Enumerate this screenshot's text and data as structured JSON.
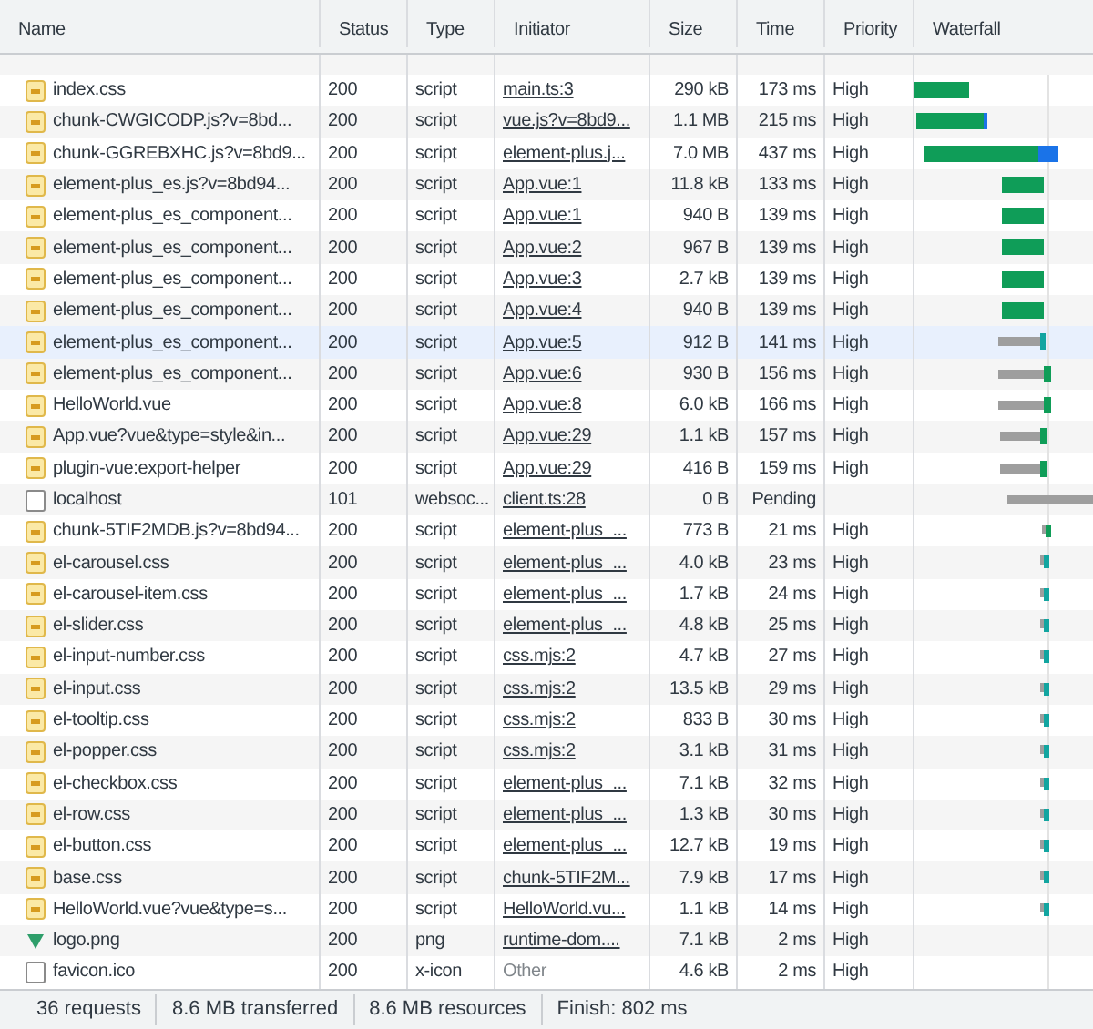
{
  "columns": [
    "Name",
    "Status",
    "Type",
    "Initiator",
    "Size",
    "Time",
    "Priority",
    "Waterfall"
  ],
  "rows": [
    {
      "name": "index.css",
      "kind": "script",
      "status": "200",
      "type": "script",
      "initiator": "main.ts:3",
      "initiator_link": true,
      "size": "290 kB",
      "time": "173 ms",
      "priority": "High",
      "selected": false
    },
    {
      "name": "chunk-CWGICODP.js?v=8bd...",
      "kind": "script",
      "status": "200",
      "type": "script",
      "initiator": "vue.js?v=8bd9...",
      "initiator_link": true,
      "size": "1.1 MB",
      "time": "215 ms",
      "priority": "High",
      "selected": false
    },
    {
      "name": "chunk-GGREBXHC.js?v=8bd9...",
      "kind": "script",
      "status": "200",
      "type": "script",
      "initiator": "element-plus.j...",
      "initiator_link": true,
      "size": "7.0 MB",
      "time": "437 ms",
      "priority": "High",
      "selected": false
    },
    {
      "name": "element-plus_es.js?v=8bd94...",
      "kind": "script",
      "status": "200",
      "type": "script",
      "initiator": "App.vue:1",
      "initiator_link": true,
      "size": "11.8 kB",
      "time": "133 ms",
      "priority": "High",
      "selected": false
    },
    {
      "name": "element-plus_es_component...",
      "kind": "script",
      "status": "200",
      "type": "script",
      "initiator": "App.vue:1",
      "initiator_link": true,
      "size": "940 B",
      "time": "139 ms",
      "priority": "High",
      "selected": false
    },
    {
      "name": "element-plus_es_component...",
      "kind": "script",
      "status": "200",
      "type": "script",
      "initiator": "App.vue:2",
      "initiator_link": true,
      "size": "967 B",
      "time": "139 ms",
      "priority": "High",
      "selected": false
    },
    {
      "name": "element-plus_es_component...",
      "kind": "script",
      "status": "200",
      "type": "script",
      "initiator": "App.vue:3",
      "initiator_link": true,
      "size": "2.7 kB",
      "time": "139 ms",
      "priority": "High",
      "selected": false
    },
    {
      "name": "element-plus_es_component...",
      "kind": "script",
      "status": "200",
      "type": "script",
      "initiator": "App.vue:4",
      "initiator_link": true,
      "size": "940 B",
      "time": "139 ms",
      "priority": "High",
      "selected": false
    },
    {
      "name": "element-plus_es_component...",
      "kind": "script",
      "status": "200",
      "type": "script",
      "initiator": "App.vue:5",
      "initiator_link": true,
      "size": "912 B",
      "time": "141 ms",
      "priority": "High",
      "selected": true
    },
    {
      "name": "element-plus_es_component...",
      "kind": "script",
      "status": "200",
      "type": "script",
      "initiator": "App.vue:6",
      "initiator_link": true,
      "size": "930 B",
      "time": "156 ms",
      "priority": "High",
      "selected": false
    },
    {
      "name": "HelloWorld.vue",
      "kind": "script",
      "status": "200",
      "type": "script",
      "initiator": "App.vue:8",
      "initiator_link": true,
      "size": "6.0 kB",
      "time": "166 ms",
      "priority": "High",
      "selected": false
    },
    {
      "name": "App.vue?vue&type=style&in...",
      "kind": "script",
      "status": "200",
      "type": "script",
      "initiator": "App.vue:29",
      "initiator_link": true,
      "size": "1.1 kB",
      "time": "157 ms",
      "priority": "High",
      "selected": false
    },
    {
      "name": "plugin-vue:export-helper",
      "kind": "script",
      "status": "200",
      "type": "script",
      "initiator": "App.vue:29",
      "initiator_link": true,
      "size": "416 B",
      "time": "159 ms",
      "priority": "High",
      "selected": false
    },
    {
      "name": "localhost",
      "kind": "document",
      "status": "101",
      "type": "websoc...",
      "initiator": "client.ts:28",
      "initiator_link": true,
      "size": "0 B",
      "time": "Pending",
      "priority": "",
      "selected": false
    },
    {
      "name": "chunk-5TIF2MDB.js?v=8bd94...",
      "kind": "script",
      "status": "200",
      "type": "script",
      "initiator": "element-plus_...",
      "initiator_link": true,
      "size": "773 B",
      "time": "21 ms",
      "priority": "High",
      "selected": false
    },
    {
      "name": "el-carousel.css",
      "kind": "script",
      "status": "200",
      "type": "script",
      "initiator": "element-plus_...",
      "initiator_link": true,
      "size": "4.0 kB",
      "time": "23 ms",
      "priority": "High",
      "selected": false
    },
    {
      "name": "el-carousel-item.css",
      "kind": "script",
      "status": "200",
      "type": "script",
      "initiator": "element-plus_...",
      "initiator_link": true,
      "size": "1.7 kB",
      "time": "24 ms",
      "priority": "High",
      "selected": false
    },
    {
      "name": "el-slider.css",
      "kind": "script",
      "status": "200",
      "type": "script",
      "initiator": "element-plus_...",
      "initiator_link": true,
      "size": "4.8 kB",
      "time": "25 ms",
      "priority": "High",
      "selected": false
    },
    {
      "name": "el-input-number.css",
      "kind": "script",
      "status": "200",
      "type": "script",
      "initiator": "css.mjs:2",
      "initiator_link": true,
      "size": "4.7 kB",
      "time": "27 ms",
      "priority": "High",
      "selected": false
    },
    {
      "name": "el-input.css",
      "kind": "script",
      "status": "200",
      "type": "script",
      "initiator": "css.mjs:2",
      "initiator_link": true,
      "size": "13.5 kB",
      "time": "29 ms",
      "priority": "High",
      "selected": false
    },
    {
      "name": "el-tooltip.css",
      "kind": "script",
      "status": "200",
      "type": "script",
      "initiator": "css.mjs:2",
      "initiator_link": true,
      "size": "833 B",
      "time": "30 ms",
      "priority": "High",
      "selected": false
    },
    {
      "name": "el-popper.css",
      "kind": "script",
      "status": "200",
      "type": "script",
      "initiator": "css.mjs:2",
      "initiator_link": true,
      "size": "3.1 kB",
      "time": "31 ms",
      "priority": "High",
      "selected": false
    },
    {
      "name": "el-checkbox.css",
      "kind": "script",
      "status": "200",
      "type": "script",
      "initiator": "element-plus_...",
      "initiator_link": true,
      "size": "7.1 kB",
      "time": "32 ms",
      "priority": "High",
      "selected": false
    },
    {
      "name": "el-row.css",
      "kind": "script",
      "status": "200",
      "type": "script",
      "initiator": "element-plus_...",
      "initiator_link": true,
      "size": "1.3 kB",
      "time": "30 ms",
      "priority": "High",
      "selected": false
    },
    {
      "name": "el-button.css",
      "kind": "script",
      "status": "200",
      "type": "script",
      "initiator": "element-plus_...",
      "initiator_link": true,
      "size": "12.7 kB",
      "time": "19 ms",
      "priority": "High",
      "selected": false
    },
    {
      "name": "base.css",
      "kind": "script",
      "status": "200",
      "type": "script",
      "initiator": "chunk-5TIF2M...",
      "initiator_link": true,
      "size": "7.9 kB",
      "time": "17 ms",
      "priority": "High",
      "selected": false
    },
    {
      "name": "HelloWorld.vue?vue&type=s...",
      "kind": "script",
      "status": "200",
      "type": "script",
      "initiator": "HelloWorld.vu...",
      "initiator_link": true,
      "size": "1.1 kB",
      "time": "14 ms",
      "priority": "High",
      "selected": false
    },
    {
      "name": "logo.png",
      "kind": "image",
      "status": "200",
      "type": "png",
      "initiator": "runtime-dom....",
      "initiator_link": true,
      "size": "7.1 kB",
      "time": "2 ms",
      "priority": "High",
      "selected": false
    },
    {
      "name": "favicon.ico",
      "kind": "document",
      "status": "200",
      "type": "x-icon",
      "initiator": "Other",
      "initiator_link": false,
      "size": "4.6 kB",
      "time": "2 ms",
      "priority": "High",
      "selected": false
    }
  ],
  "status_bar": [
    "36 requests",
    "8.6 MB transferred",
    "8.6 MB resources",
    "Finish: 802 ms"
  ]
}
